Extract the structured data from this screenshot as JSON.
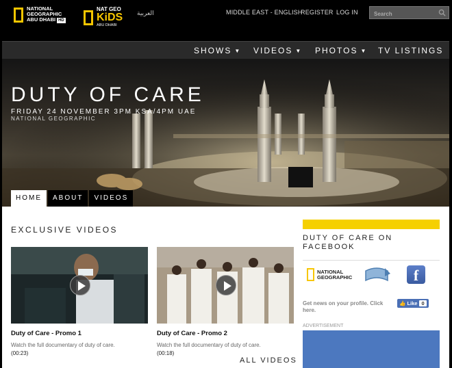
{
  "header": {
    "logo_ng": [
      "NATIONAL",
      "GEOGRAPHIC",
      "ABU DHABI"
    ],
    "logo_ng_hd": "HD",
    "logo_kids": {
      "line1": "NAT GEO",
      "line2": "KiDS",
      "line3": "ABU DHABI"
    },
    "arabic_link": "العربية",
    "region": "MIDDLE EAST - ENGLISH",
    "register": "REGISTER",
    "login": "LOG IN",
    "search_placeholder": "Search"
  },
  "nav": [
    {
      "label": "SHOWS",
      "dropdown": true
    },
    {
      "label": "VIDEOS",
      "dropdown": true
    },
    {
      "label": "PHOTOS",
      "dropdown": true
    },
    {
      "label": "TV LISTINGS",
      "dropdown": false
    }
  ],
  "hero": {
    "title": "DUTY OF CARE",
    "date": "FRIDAY 24 NOVEMBER 3PM KSA/4PM UAE",
    "channel": "NATIONAL GEOGRAPHIC",
    "tabs": [
      "HOME",
      "ABOUT",
      "VIDEOS"
    ],
    "active_tab": "HOME"
  },
  "exclusive": {
    "title": "EXCLUSIVE VIDEOS",
    "videos": [
      {
        "title": "Duty of Care - Promo 1",
        "description": "Watch the full documentary of duty of care.",
        "duration": "(00:23)"
      },
      {
        "title": "Duty of Care - Promo 2",
        "description": "Watch the full documentary of duty of care.",
        "duration": "(00:18)"
      }
    ],
    "all_videos": "ALL VIDEOS"
  },
  "sidebar": {
    "title": "DUTY OF CARE ON FACEBOOK",
    "ng_logo": [
      "NATIONAL",
      "GEOGRAPHIC"
    ],
    "get_news": "Get news on your profile. Click here.",
    "like_label": "Like",
    "like_count": "0",
    "advertisement": "ADVERTISEMENT"
  },
  "colors": {
    "brand_yellow": "#f5d000",
    "facebook_blue": "#3b5998",
    "ad_blue": "#4c78bf"
  }
}
